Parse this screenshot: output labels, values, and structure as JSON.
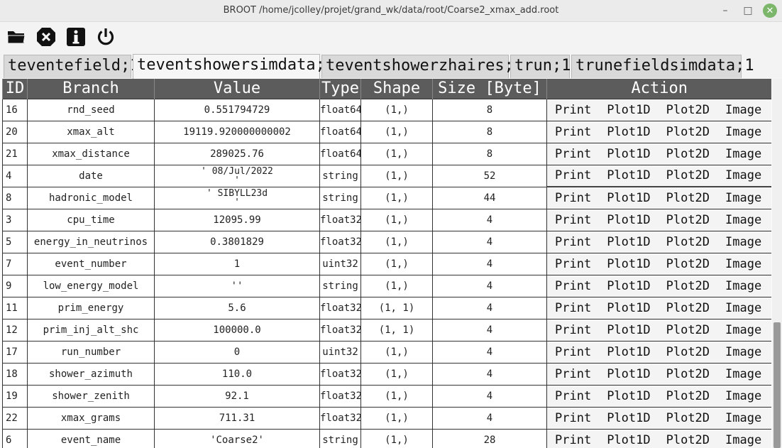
{
  "window": {
    "title": "BROOT /home/jcolley/projet/grand_wk/data/root/Coarse2_xmax_add.root",
    "minimize": "–",
    "maximize": "□",
    "close": "✕"
  },
  "toolbar": {
    "icons": [
      "folder-open-icon",
      "close-file-icon",
      "info-icon",
      "power-icon"
    ]
  },
  "tabs": [
    {
      "label": "teventefield;1",
      "active": false
    },
    {
      "label": "teventshowersimdata;1",
      "active": true
    },
    {
      "label": "teventshowerzhaires;1",
      "active": false
    },
    {
      "label": "trun;1",
      "active": false
    },
    {
      "label": "trunefieldsimdata;1",
      "active": false
    }
  ],
  "table": {
    "headers": {
      "id": "ID",
      "branch": "Branch",
      "value": "Value",
      "type": "Type",
      "shape": "Shape",
      "size": "Size [Byte]",
      "action": "Action"
    },
    "actions": [
      "Print",
      "Plot1D",
      "Plot2D",
      "Image"
    ],
    "rows": [
      {
        "id": "16",
        "branch": "rnd_seed",
        "value": "0.551794729",
        "value2": "",
        "type": "float64",
        "shape": "(1,)",
        "size": "8"
      },
      {
        "id": "20",
        "branch": "xmax_alt",
        "value": "19119.920000000002",
        "value2": "",
        "type": "float64",
        "shape": "(1,)",
        "size": "8"
      },
      {
        "id": "21",
        "branch": "xmax_distance",
        "value": "289025.76",
        "value2": "",
        "type": "float64",
        "shape": "(1,)",
        "size": "8"
      },
      {
        "id": "4",
        "branch": "date",
        "value": "' 08/Jul/2022",
        "value2": "'",
        "type": "string",
        "shape": "(1,)",
        "size": "52"
      },
      {
        "id": "8",
        "branch": "hadronic_model",
        "value": "' SIBYLL23d",
        "value2": "'",
        "type": "string",
        "shape": "(1,)",
        "size": "44"
      },
      {
        "id": "3",
        "branch": "cpu_time",
        "value": "12095.99",
        "value2": "",
        "type": "float32",
        "shape": "(1,)",
        "size": "4"
      },
      {
        "id": "5",
        "branch": "energy_in_neutrinos",
        "value": "0.3801829",
        "value2": "",
        "type": "float32",
        "shape": "(1,)",
        "size": "4"
      },
      {
        "id": "7",
        "branch": "event_number",
        "value": "1",
        "value2": "",
        "type": "uint32",
        "shape": "(1,)",
        "size": "4"
      },
      {
        "id": "9",
        "branch": "low_energy_model",
        "value": "''",
        "value2": "",
        "type": "string",
        "shape": "(1,)",
        "size": "4"
      },
      {
        "id": "11",
        "branch": "prim_energy",
        "value": "5.6",
        "value2": "",
        "type": "float32",
        "shape": "(1, 1)",
        "size": "4"
      },
      {
        "id": "12",
        "branch": "prim_inj_alt_shc",
        "value": "100000.0",
        "value2": "",
        "type": "float32",
        "shape": "(1, 1)",
        "size": "4"
      },
      {
        "id": "17",
        "branch": "run_number",
        "value": "0",
        "value2": "",
        "type": "uint32",
        "shape": "(1,)",
        "size": "4"
      },
      {
        "id": "18",
        "branch": "shower_azimuth",
        "value": "110.0",
        "value2": "",
        "type": "float32",
        "shape": "(1,)",
        "size": "4"
      },
      {
        "id": "19",
        "branch": "shower_zenith",
        "value": "92.1",
        "value2": "",
        "type": "float32",
        "shape": "(1,)",
        "size": "4"
      },
      {
        "id": "22",
        "branch": "xmax_grams",
        "value": "711.31",
        "value2": "",
        "type": "float32",
        "shape": "(1,)",
        "size": "4"
      },
      {
        "id": "6",
        "branch": "event_name",
        "value": "'Coarse2'",
        "value2": "",
        "type": "string",
        "shape": "(1,)",
        "size": "28"
      }
    ]
  },
  "scrollbar": {
    "position_fraction": 0.66,
    "visible_fraction": 0.34
  }
}
